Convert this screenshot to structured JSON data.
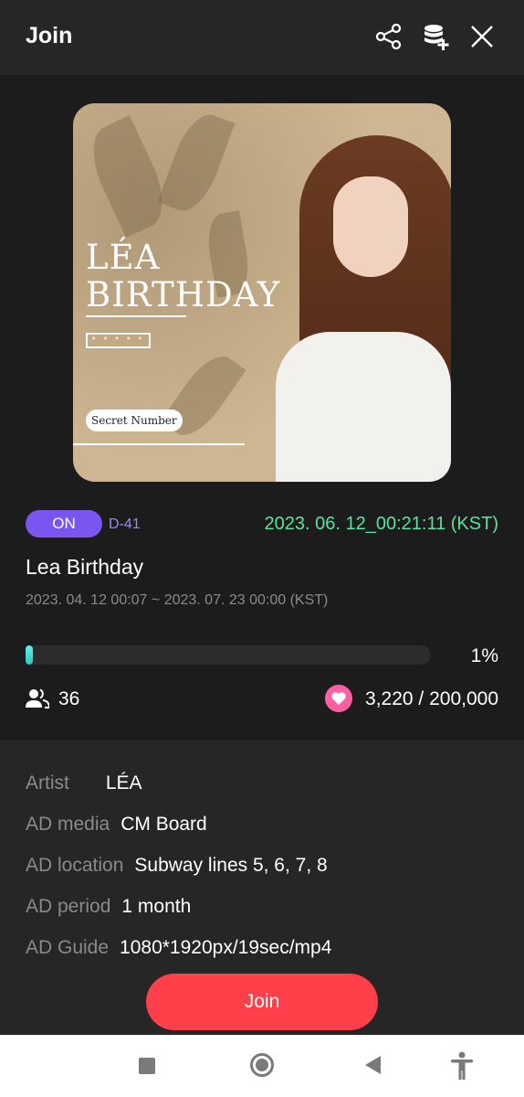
{
  "header": {
    "title": "Join",
    "icons": [
      "share-icon",
      "database-add-icon",
      "close-icon"
    ]
  },
  "poster": {
    "title_line1": "LÉA",
    "title_line2": "BIRTHDAY",
    "stars": "* * * * *",
    "badge": "Secret Number"
  },
  "status": {
    "badge": "ON",
    "dday": "D-41",
    "timestamp": "2023. 06. 12_00:21:11 (KST)"
  },
  "event": {
    "title": "Lea Birthday",
    "period": "2023. 04. 12 00:07 ~ 2023. 07. 23 00:00 (KST)"
  },
  "progress": {
    "percent_label": "1%",
    "fill_percent": 1
  },
  "stats": {
    "participants": "36",
    "likes": "3,220 / 200,000"
  },
  "details": [
    {
      "key": "Artist",
      "value": "LÉA"
    },
    {
      "key": "AD media",
      "value": "CM Board"
    },
    {
      "key": "AD location",
      "value": "Subway lines 5, 6, 7, 8"
    },
    {
      "key": "AD period",
      "value": "1 month"
    },
    {
      "key": "AD Guide",
      "value": "1080*1920px/19sec/mp4"
    }
  ],
  "join_button": "Join",
  "colors": {
    "accent_purple": "#7a55f0",
    "timestamp_green": "#59e39d",
    "join_red": "#ff3f49",
    "progress_cyan": "#28c7c0",
    "heart_pink": "#ff5fa2"
  },
  "system_nav": [
    "recent-apps-icon",
    "home-icon",
    "back-icon",
    "accessibility-icon"
  ]
}
